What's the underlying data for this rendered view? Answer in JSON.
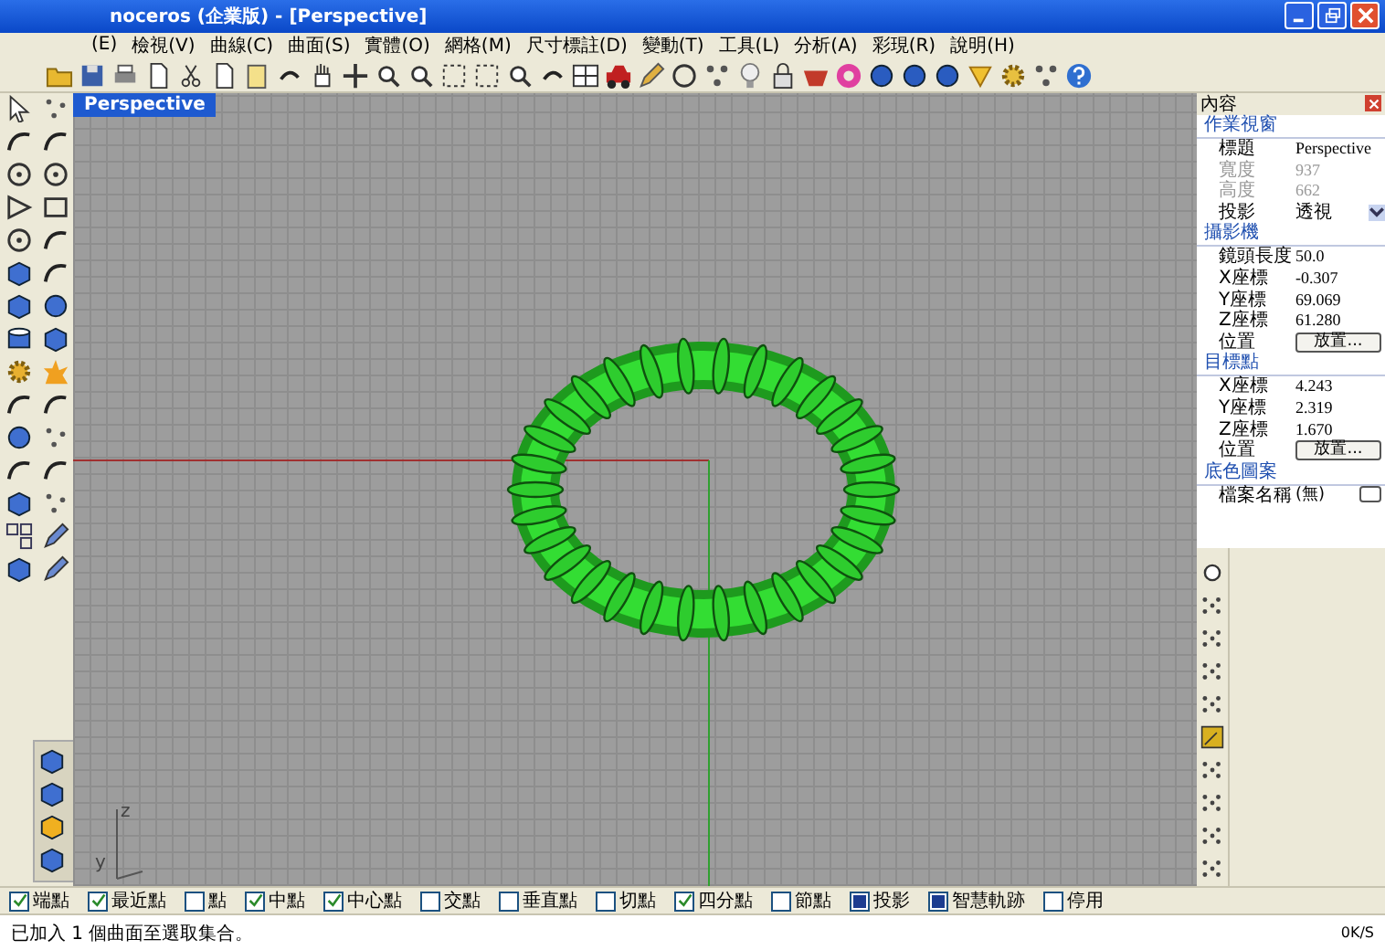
{
  "window": {
    "title": "noceros (企業版) - [Perspective]"
  },
  "menu": [
    "(E)",
    "檢視(V)",
    "曲線(C)",
    "曲面(S)",
    "實體(O)",
    "網格(M)",
    "尺寸標註(D)",
    "變動(T)",
    "工具(L)",
    "分析(A)",
    "彩現(R)",
    "說明(H)"
  ],
  "viewport": {
    "tab": "Perspective",
    "axis_labels": [
      "z",
      "y"
    ]
  },
  "properties": {
    "title": "內容",
    "sections": [
      {
        "heading": "作業視窗",
        "rows": [
          {
            "kind": "text",
            "label": "標題",
            "value": "Perspective",
            "disabled": false
          },
          {
            "kind": "text",
            "label": "寬度",
            "value": "937",
            "disabled": true
          },
          {
            "kind": "text",
            "label": "高度",
            "value": "662",
            "disabled": true
          },
          {
            "kind": "select",
            "label": "投影",
            "value": "透視",
            "disabled": false
          }
        ]
      },
      {
        "heading": "攝影機",
        "rows": [
          {
            "kind": "text",
            "label": "鏡頭長度",
            "value": "50.0",
            "disabled": false
          },
          {
            "kind": "text",
            "label": "X座標",
            "value": "-0.307",
            "disabled": false
          },
          {
            "kind": "text",
            "label": "Y座標",
            "value": "69.069",
            "disabled": false
          },
          {
            "kind": "text",
            "label": "Z座標",
            "value": "61.280",
            "disabled": false
          },
          {
            "kind": "button",
            "label": "位置",
            "value": "放置...",
            "disabled": false
          }
        ]
      },
      {
        "heading": "目標點",
        "rows": [
          {
            "kind": "text",
            "label": "X座標",
            "value": "4.243",
            "disabled": false
          },
          {
            "kind": "text",
            "label": "Y座標",
            "value": "2.319",
            "disabled": false
          },
          {
            "kind": "text",
            "label": "Z座標",
            "value": "1.670",
            "disabled": false
          },
          {
            "kind": "button",
            "label": "位置",
            "value": "放置...",
            "disabled": false
          }
        ]
      },
      {
        "heading": "底色圖案",
        "rows": [
          {
            "kind": "browse",
            "label": "檔案名稱",
            "value": "(無)",
            "disabled": false
          }
        ]
      }
    ]
  },
  "osnap": [
    {
      "kind": "check",
      "label": "端點",
      "checked": true
    },
    {
      "kind": "check",
      "label": "最近點",
      "checked": true
    },
    {
      "kind": "check",
      "label": "點",
      "checked": false
    },
    {
      "kind": "check",
      "label": "中點",
      "checked": true
    },
    {
      "kind": "check",
      "label": "中心點",
      "checked": true
    },
    {
      "kind": "check",
      "label": "交點",
      "checked": false
    },
    {
      "kind": "check",
      "label": "垂直點",
      "checked": false
    },
    {
      "kind": "check",
      "label": "切點",
      "checked": false
    },
    {
      "kind": "check",
      "label": "四分點",
      "checked": true
    },
    {
      "kind": "check",
      "label": "節點",
      "checked": false
    },
    {
      "kind": "toggle",
      "label": "投影",
      "checked": true
    },
    {
      "kind": "toggle",
      "label": "智慧軌跡",
      "checked": true
    },
    {
      "kind": "check",
      "label": "停用",
      "checked": false
    }
  ],
  "status_bar": {
    "message": "已加入 1 個曲面至選取集合。",
    "speed": "0K/S"
  }
}
